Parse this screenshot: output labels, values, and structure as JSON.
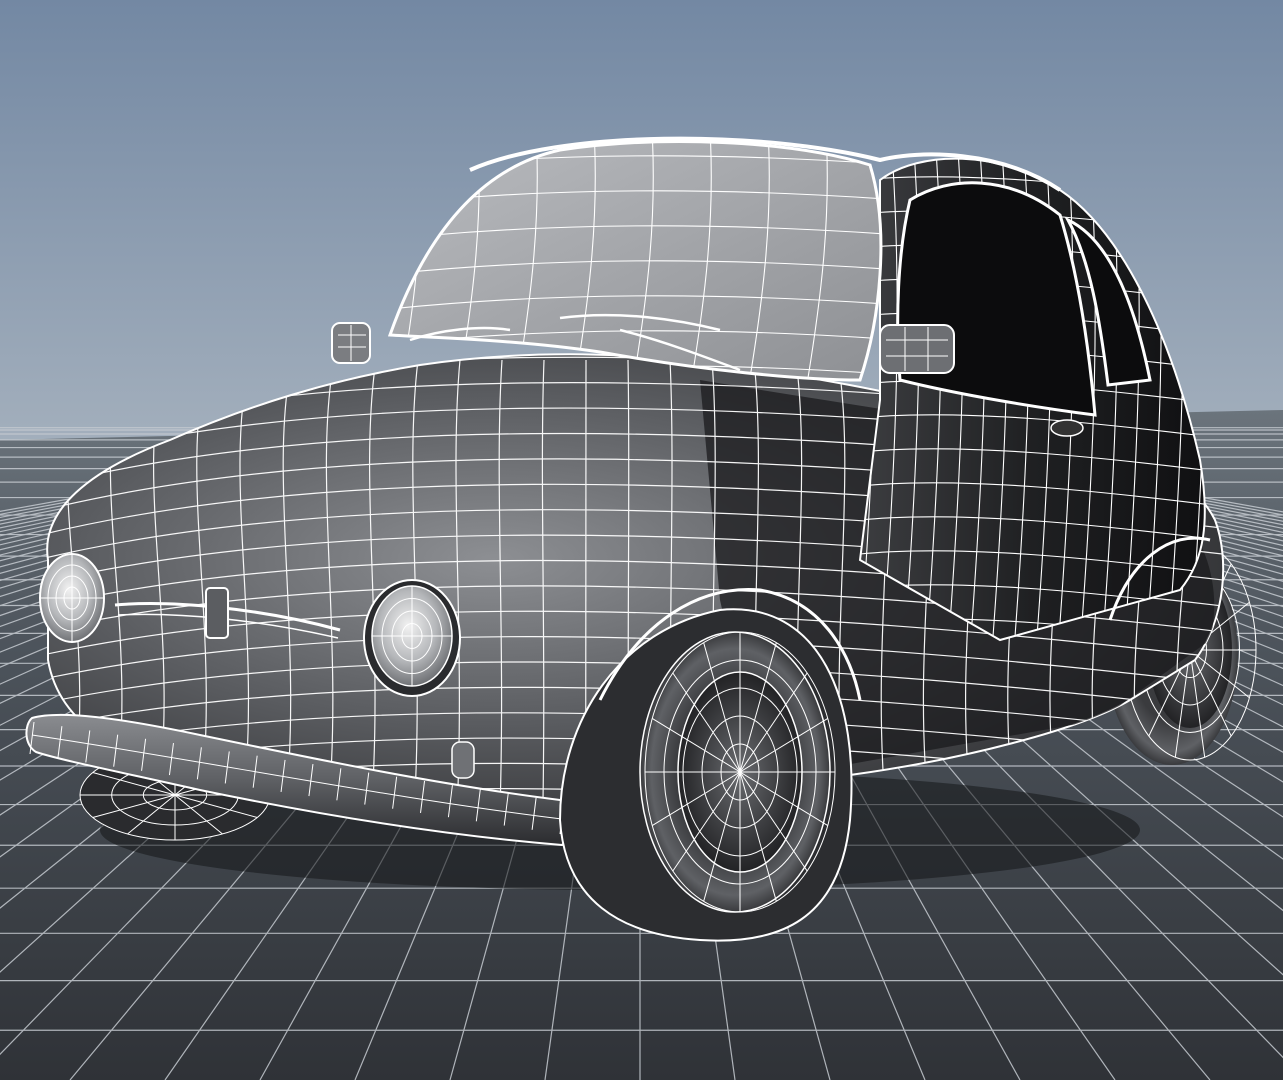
{
  "viewport": {
    "background_top": "#7388a3",
    "background_mid": "#a4b0bd",
    "background_bottom": "#5f6e7f",
    "floor_near": "#2f3237",
    "floor_far": "#6b747c",
    "grid_color": "#c6cbd1",
    "wireframe_color": "#ffffff",
    "shaded_dark": "#1d1d1f",
    "shaded_mid": "#5a5c60",
    "shaded_light": "#a6a8ab",
    "glass": "#a9abaf"
  },
  "scene": {
    "object": "car-model",
    "display_mode": "wireframe-on-shaded",
    "parts": [
      "body",
      "windshield",
      "side-windows",
      "left-mirror",
      "right-mirror",
      "wipers",
      "left-headlight",
      "right-headlight",
      "front-badge",
      "front-bumper",
      "front-left-wheel",
      "front-right-wheel",
      "rear-wheel",
      "door-handle",
      "turn-signal"
    ]
  }
}
